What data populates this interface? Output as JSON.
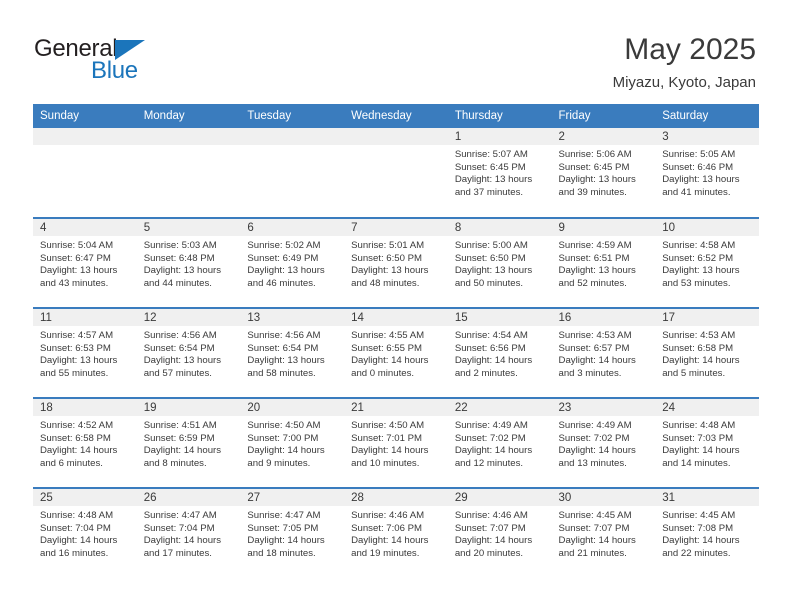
{
  "brand": {
    "name_top": "General",
    "name_bottom": "Blue",
    "triangle_color": "#1b75bb",
    "text_color": "#231f20"
  },
  "header": {
    "title": "May 2025",
    "subtitle": "Miyazu, Kyoto, Japan",
    "accent_color": "#3a7cbe"
  },
  "calendar": {
    "weekday_headers": [
      "Sunday",
      "Monday",
      "Tuesday",
      "Wednesday",
      "Thursday",
      "Friday",
      "Saturday"
    ],
    "header_bg": "#3a7cbe",
    "daynum_bg": "#f0f0f0",
    "labels": {
      "sunrise": "Sunrise:",
      "sunset": "Sunset:",
      "daylight": "Daylight:"
    },
    "weeks": [
      [
        {
          "day": "",
          "empty": true
        },
        {
          "day": "",
          "empty": true
        },
        {
          "day": "",
          "empty": true
        },
        {
          "day": "",
          "empty": true
        },
        {
          "day": "1",
          "sunrise": "Sunrise: 5:07 AM",
          "sunset": "Sunset: 6:45 PM",
          "daylight": "Daylight: 13 hours and 37 minutes."
        },
        {
          "day": "2",
          "sunrise": "Sunrise: 5:06 AM",
          "sunset": "Sunset: 6:45 PM",
          "daylight": "Daylight: 13 hours and 39 minutes."
        },
        {
          "day": "3",
          "sunrise": "Sunrise: 5:05 AM",
          "sunset": "Sunset: 6:46 PM",
          "daylight": "Daylight: 13 hours and 41 minutes."
        }
      ],
      [
        {
          "day": "4",
          "sunrise": "Sunrise: 5:04 AM",
          "sunset": "Sunset: 6:47 PM",
          "daylight": "Daylight: 13 hours and 43 minutes."
        },
        {
          "day": "5",
          "sunrise": "Sunrise: 5:03 AM",
          "sunset": "Sunset: 6:48 PM",
          "daylight": "Daylight: 13 hours and 44 minutes."
        },
        {
          "day": "6",
          "sunrise": "Sunrise: 5:02 AM",
          "sunset": "Sunset: 6:49 PM",
          "daylight": "Daylight: 13 hours and 46 minutes."
        },
        {
          "day": "7",
          "sunrise": "Sunrise: 5:01 AM",
          "sunset": "Sunset: 6:50 PM",
          "daylight": "Daylight: 13 hours and 48 minutes."
        },
        {
          "day": "8",
          "sunrise": "Sunrise: 5:00 AM",
          "sunset": "Sunset: 6:50 PM",
          "daylight": "Daylight: 13 hours and 50 minutes."
        },
        {
          "day": "9",
          "sunrise": "Sunrise: 4:59 AM",
          "sunset": "Sunset: 6:51 PM",
          "daylight": "Daylight: 13 hours and 52 minutes."
        },
        {
          "day": "10",
          "sunrise": "Sunrise: 4:58 AM",
          "sunset": "Sunset: 6:52 PM",
          "daylight": "Daylight: 13 hours and 53 minutes."
        }
      ],
      [
        {
          "day": "11",
          "sunrise": "Sunrise: 4:57 AM",
          "sunset": "Sunset: 6:53 PM",
          "daylight": "Daylight: 13 hours and 55 minutes."
        },
        {
          "day": "12",
          "sunrise": "Sunrise: 4:56 AM",
          "sunset": "Sunset: 6:54 PM",
          "daylight": "Daylight: 13 hours and 57 minutes."
        },
        {
          "day": "13",
          "sunrise": "Sunrise: 4:56 AM",
          "sunset": "Sunset: 6:54 PM",
          "daylight": "Daylight: 13 hours and 58 minutes."
        },
        {
          "day": "14",
          "sunrise": "Sunrise: 4:55 AM",
          "sunset": "Sunset: 6:55 PM",
          "daylight": "Daylight: 14 hours and 0 minutes."
        },
        {
          "day": "15",
          "sunrise": "Sunrise: 4:54 AM",
          "sunset": "Sunset: 6:56 PM",
          "daylight": "Daylight: 14 hours and 2 minutes."
        },
        {
          "day": "16",
          "sunrise": "Sunrise: 4:53 AM",
          "sunset": "Sunset: 6:57 PM",
          "daylight": "Daylight: 14 hours and 3 minutes."
        },
        {
          "day": "17",
          "sunrise": "Sunrise: 4:53 AM",
          "sunset": "Sunset: 6:58 PM",
          "daylight": "Daylight: 14 hours and 5 minutes."
        }
      ],
      [
        {
          "day": "18",
          "sunrise": "Sunrise: 4:52 AM",
          "sunset": "Sunset: 6:58 PM",
          "daylight": "Daylight: 14 hours and 6 minutes."
        },
        {
          "day": "19",
          "sunrise": "Sunrise: 4:51 AM",
          "sunset": "Sunset: 6:59 PM",
          "daylight": "Daylight: 14 hours and 8 minutes."
        },
        {
          "day": "20",
          "sunrise": "Sunrise: 4:50 AM",
          "sunset": "Sunset: 7:00 PM",
          "daylight": "Daylight: 14 hours and 9 minutes."
        },
        {
          "day": "21",
          "sunrise": "Sunrise: 4:50 AM",
          "sunset": "Sunset: 7:01 PM",
          "daylight": "Daylight: 14 hours and 10 minutes."
        },
        {
          "day": "22",
          "sunrise": "Sunrise: 4:49 AM",
          "sunset": "Sunset: 7:02 PM",
          "daylight": "Daylight: 14 hours and 12 minutes."
        },
        {
          "day": "23",
          "sunrise": "Sunrise: 4:49 AM",
          "sunset": "Sunset: 7:02 PM",
          "daylight": "Daylight: 14 hours and 13 minutes."
        },
        {
          "day": "24",
          "sunrise": "Sunrise: 4:48 AM",
          "sunset": "Sunset: 7:03 PM",
          "daylight": "Daylight: 14 hours and 14 minutes."
        }
      ],
      [
        {
          "day": "25",
          "sunrise": "Sunrise: 4:48 AM",
          "sunset": "Sunset: 7:04 PM",
          "daylight": "Daylight: 14 hours and 16 minutes."
        },
        {
          "day": "26",
          "sunrise": "Sunrise: 4:47 AM",
          "sunset": "Sunset: 7:04 PM",
          "daylight": "Daylight: 14 hours and 17 minutes."
        },
        {
          "day": "27",
          "sunrise": "Sunrise: 4:47 AM",
          "sunset": "Sunset: 7:05 PM",
          "daylight": "Daylight: 14 hours and 18 minutes."
        },
        {
          "day": "28",
          "sunrise": "Sunrise: 4:46 AM",
          "sunset": "Sunset: 7:06 PM",
          "daylight": "Daylight: 14 hours and 19 minutes."
        },
        {
          "day": "29",
          "sunrise": "Sunrise: 4:46 AM",
          "sunset": "Sunset: 7:07 PM",
          "daylight": "Daylight: 14 hours and 20 minutes."
        },
        {
          "day": "30",
          "sunrise": "Sunrise: 4:45 AM",
          "sunset": "Sunset: 7:07 PM",
          "daylight": "Daylight: 14 hours and 21 minutes."
        },
        {
          "day": "31",
          "sunrise": "Sunrise: 4:45 AM",
          "sunset": "Sunset: 7:08 PM",
          "daylight": "Daylight: 14 hours and 22 minutes."
        }
      ]
    ]
  }
}
